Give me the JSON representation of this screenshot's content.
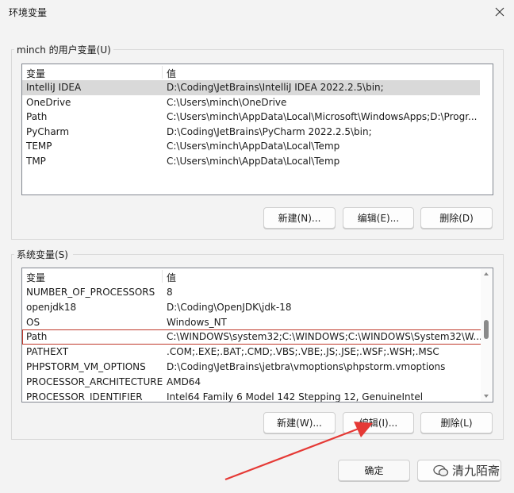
{
  "window": {
    "title": "环境变量",
    "close_icon": "close-icon"
  },
  "user_vars": {
    "group_label": "minch 的用户变量(U)",
    "col_name": "变量",
    "col_value": "值",
    "rows": [
      {
        "name": "IntelliJ IDEA",
        "value": "D:\\Coding\\JetBrains\\IntelliJ IDEA 2022.2.5\\bin;"
      },
      {
        "name": "OneDrive",
        "value": "C:\\Users\\minch\\OneDrive"
      },
      {
        "name": "Path",
        "value": "C:\\Users\\minch\\AppData\\Local\\Microsoft\\WindowsApps;D:\\Progr..."
      },
      {
        "name": "PyCharm",
        "value": "D:\\Coding\\JetBrains\\PyCharm 2022.2.5\\bin;"
      },
      {
        "name": "TEMP",
        "value": "C:\\Users\\minch\\AppData\\Local\\Temp"
      },
      {
        "name": "TMP",
        "value": "C:\\Users\\minch\\AppData\\Local\\Temp"
      }
    ],
    "new_label": "新建(N)...",
    "edit_label": "编辑(E)...",
    "delete_label": "删除(D)"
  },
  "system_vars": {
    "group_label": "系统变量(S)",
    "col_name": "变量",
    "col_value": "值",
    "rows": [
      {
        "name": "NUMBER_OF_PROCESSORS",
        "value": "8"
      },
      {
        "name": "openjdk18",
        "value": "D:\\Coding\\OpenJDK\\jdk-18"
      },
      {
        "name": "OS",
        "value": "Windows_NT"
      },
      {
        "name": "Path",
        "value": "C:\\WINDOWS\\system32;C:\\WINDOWS;C:\\WINDOWS\\System32\\W..."
      },
      {
        "name": "PATHEXT",
        "value": ".COM;.EXE;.BAT;.CMD;.VBS;.VBE;.JS;.JSE;.WSF;.WSH;.MSC"
      },
      {
        "name": "PHPSTORM_VM_OPTIONS",
        "value": "D:\\Coding\\JetBrains\\jetbra\\vmoptions\\phpstorm.vmoptions"
      },
      {
        "name": "PROCESSOR_ARCHITECTURE",
        "value": "AMD64"
      },
      {
        "name": "PROCESSOR_IDENTIFIER",
        "value": "Intel64 Family 6 Model 142 Stepping 12, GenuineIntel"
      }
    ],
    "new_label": "新建(W)...",
    "edit_label": "编辑(I)...",
    "delete_label": "删除(L)"
  },
  "footer": {
    "ok_label": "确定"
  },
  "watermark": {
    "text": "清九陌斋"
  },
  "colors": {
    "highlight_outline": "#c0392b",
    "arrow": "#e53935",
    "selected_row": "#d9d9d9"
  }
}
